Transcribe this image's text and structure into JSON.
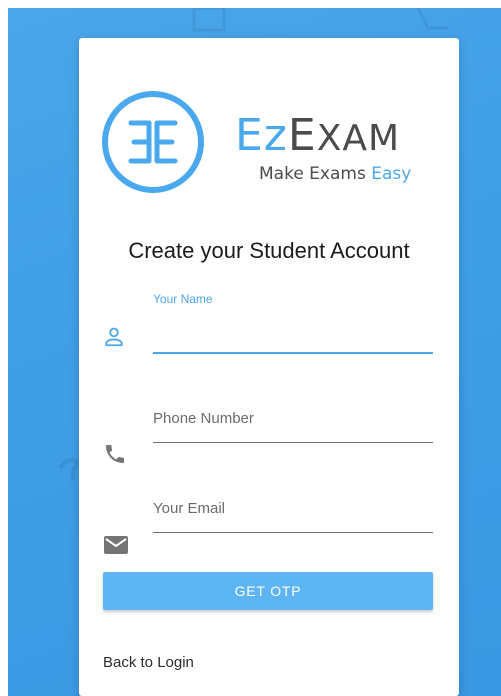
{
  "logo": {
    "monogram": "EE",
    "brand_ez": "Ez",
    "brand_exam_first": "E",
    "brand_exam_rest": "XAM",
    "tagline_prefix": "Make Exams ",
    "tagline_highlight": "Easy",
    "accent_color": "#4aa8ee",
    "dark_color": "#4b4b4b"
  },
  "form": {
    "title": "Create your Student Account",
    "name_field": {
      "label": "Your Name",
      "value": "",
      "icon": "person-icon"
    },
    "phone_field": {
      "placeholder": "Phone Number",
      "value": "",
      "icon": "phone-icon"
    },
    "email_field": {
      "placeholder": "Your Email",
      "value": "",
      "icon": "mail-icon"
    },
    "submit_label": "GET OTP",
    "back_link": "Back to Login"
  },
  "colors": {
    "background": "#3f9ee6",
    "button": "#5db5f4",
    "focus_underline": "#4aa8ee"
  }
}
